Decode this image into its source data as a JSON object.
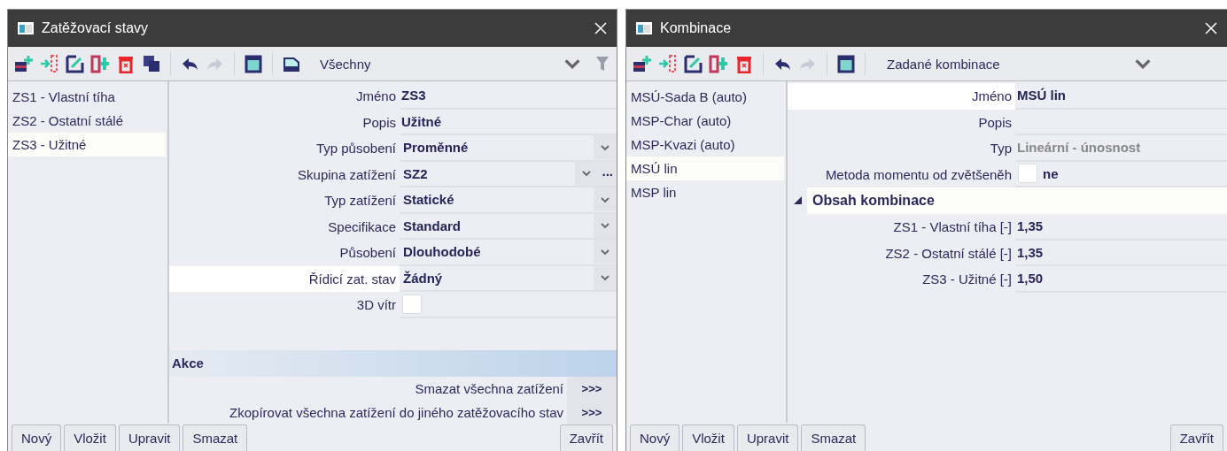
{
  "windows": [
    {
      "title": "Zatěžovací stavy",
      "toolbar": [
        {
          "kind": "add",
          "disabled": false
        },
        {
          "kind": "insert",
          "disabled": false
        },
        {
          "kind": "edit",
          "disabled": false
        },
        {
          "kind": "add-column",
          "disabled": false
        },
        {
          "kind": "delete",
          "disabled": false
        },
        {
          "kind": "copy",
          "disabled": false
        },
        {
          "kind": "separator"
        },
        {
          "kind": "undo",
          "disabled": false
        },
        {
          "kind": "redo",
          "disabled": true
        },
        {
          "kind": "separator"
        },
        {
          "kind": "table",
          "disabled": false
        },
        {
          "kind": "separator"
        },
        {
          "kind": "save",
          "disabled": false
        },
        {
          "kind": "dropdown",
          "value": "Všechny"
        },
        {
          "kind": "funnel"
        }
      ],
      "list": [
        {
          "label": "ZS1 - Vlastní tíha",
          "selected": false
        },
        {
          "label": "ZS2 - Ostatní stálé",
          "selected": false
        },
        {
          "label": "ZS3 - Užitné",
          "selected": true
        }
      ],
      "properties": [
        {
          "kind": "text",
          "label": "Jméno",
          "value": "ZS3",
          "selected": false,
          "disabled": false
        },
        {
          "kind": "text",
          "label": "Popis",
          "value": "Užitné",
          "selected": false,
          "disabled": false
        },
        {
          "kind": "dropdown",
          "label": "Typ působení",
          "value": "Proměnné",
          "selected": false
        },
        {
          "kind": "dropdown-more",
          "label": "Skupina zatížení",
          "value": "SZ2",
          "more": "...",
          "selected": false
        },
        {
          "kind": "dropdown",
          "label": "Typ zatížení",
          "value": "Statické",
          "selected": false
        },
        {
          "kind": "dropdown",
          "label": "Specifikace",
          "value": "Standard",
          "selected": false
        },
        {
          "kind": "dropdown",
          "label": "Působení",
          "value": "Dlouhodobé",
          "selected": false
        },
        {
          "kind": "dropdown",
          "label": "Řídicí zat. stav",
          "value": "Žádný",
          "selected": true
        },
        {
          "kind": "checkbox",
          "label": "3D vítr",
          "checked": false,
          "selected": false
        },
        {
          "kind": "group",
          "label": "Akce"
        },
        {
          "kind": "action",
          "label": "Smazat všechna zatížení",
          "button": ">>>"
        },
        {
          "kind": "action",
          "label": "Zkopírovat všechna zatížení do jiného zatěžovacího stav",
          "button": ">>>"
        }
      ],
      "buttons": [
        "Nový",
        "Vložit",
        "Upravit",
        "Smazat"
      ],
      "close_button": "Zavřít"
    },
    {
      "title": "Kombinace",
      "toolbar": [
        {
          "kind": "add",
          "disabled": false
        },
        {
          "kind": "insert",
          "disabled": false
        },
        {
          "kind": "edit",
          "disabled": false
        },
        {
          "kind": "add-column",
          "disabled": false
        },
        {
          "kind": "delete",
          "disabled": false
        },
        {
          "kind": "separator"
        },
        {
          "kind": "undo",
          "disabled": false
        },
        {
          "kind": "redo",
          "disabled": true
        },
        {
          "kind": "separator"
        },
        {
          "kind": "table",
          "disabled": false
        },
        {
          "kind": "separator"
        },
        {
          "kind": "dropdown",
          "value": "Zadané kombinace"
        }
      ],
      "list": [
        {
          "label": "MSÚ-Sada B (auto)",
          "selected": false
        },
        {
          "label": "MSP-Char (auto)",
          "selected": false
        },
        {
          "label": "MSP-Kvazi (auto)",
          "selected": false
        },
        {
          "label": "MSÚ lin",
          "selected": true
        },
        {
          "label": "MSP lin",
          "selected": false
        }
      ],
      "properties": [
        {
          "kind": "text",
          "label": "Jméno",
          "value": "MSÚ lin",
          "selected": true,
          "disabled": false
        },
        {
          "kind": "text",
          "label": "Popis",
          "selected": false
        },
        {
          "kind": "text",
          "label": "Typ",
          "value": "Lineární - únosnost",
          "selected": false,
          "disabled": true
        },
        {
          "kind": "checkbox",
          "label": "Metoda momentu od zvětšeněh",
          "checked": false,
          "value": "ne",
          "selected": false
        },
        {
          "kind": "section",
          "label": "Obsah kombinace",
          "expanded": true
        },
        {
          "kind": "text",
          "label": "ZS1 - Vlastní tíha [-]",
          "value": "1,35",
          "selected": false,
          "disabled": false
        },
        {
          "kind": "text",
          "label": "ZS2 - Ostatní stálé [-]",
          "value": "1,35",
          "selected": false,
          "disabled": false
        },
        {
          "kind": "text",
          "label": "ZS3 - Užitné [-]",
          "value": "1,50",
          "selected": false,
          "disabled": false
        }
      ],
      "buttons": [
        "Nový",
        "Vložit",
        "Upravit",
        "Smazat"
      ],
      "close_button": "Zavřít"
    }
  ]
}
